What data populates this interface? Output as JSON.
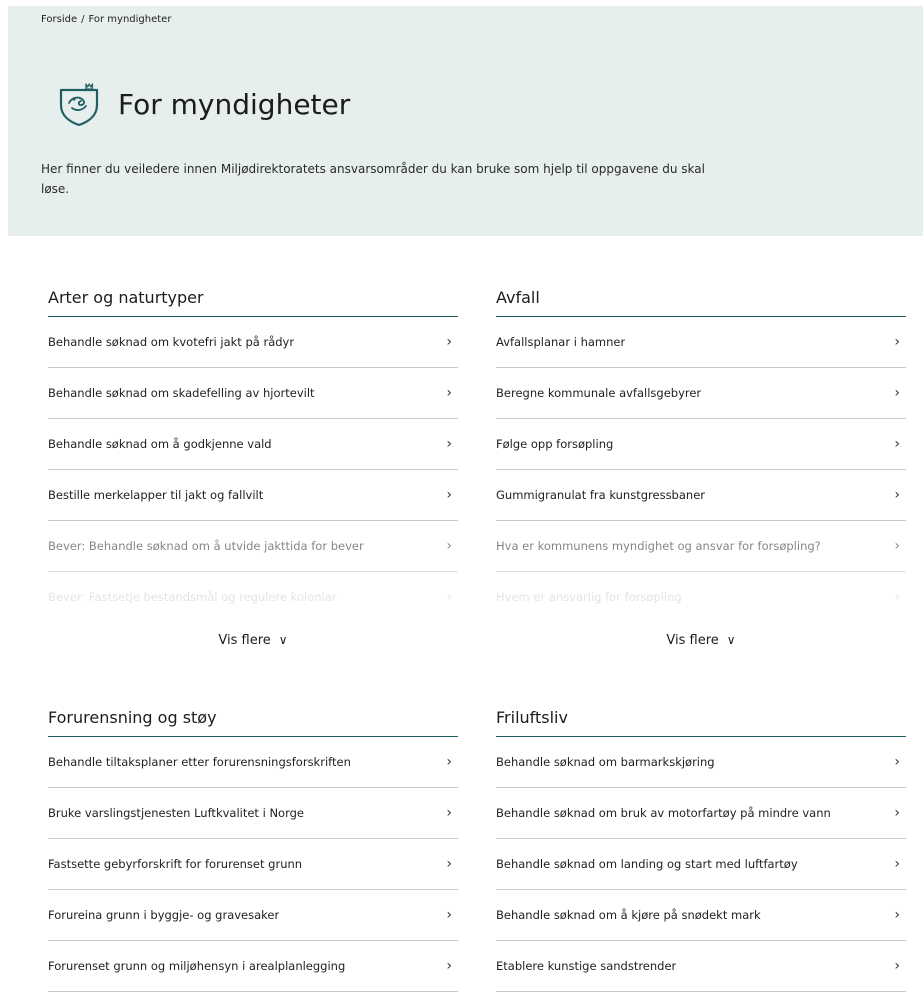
{
  "breadcrumb": {
    "home": "Forside",
    "separator": "/",
    "current": "For myndigheter"
  },
  "header": {
    "title": "For myndigheter",
    "intro": "Her finner du veiledere innen Miljødirektoratets ansvarsområder du kan bruke som hjelp til oppgavene du skal løse.",
    "icon": "authority-crest-icon"
  },
  "colors": {
    "hero_bg": "#e7eeee",
    "accent": "#1f5f62",
    "divider": "#c8c8c8"
  },
  "sections": [
    {
      "title": "Arter og naturtyper",
      "items": [
        "Behandle søknad om kvotefri jakt på rådyr",
        "Behandle søknad om skadefelling av hjortevilt",
        "Behandle søknad om å godkjenne vald",
        "Bestille merkelapper til jakt og fallvilt",
        "Bever: Behandle søknad om å utvide jakttida for bever",
        "Bever: Fastsetje bestandsmål og regulere koloniar"
      ],
      "more": "Vis flere"
    },
    {
      "title": "Avfall",
      "items": [
        "Avfallsplanar i hamner",
        "Beregne kommunale avfallsgebyrer",
        "Følge opp forsøpling",
        "Gummigranulat fra kunstgressbaner",
        "Hva er kommunens myndighet og ansvar for forsøpling?",
        "Hvem er ansvarlig for forsøpling"
      ],
      "more": "Vis flere"
    },
    {
      "title": "Forurensning og støy",
      "items": [
        "Behandle tiltaksplaner etter forurensningsforskriften",
        "Bruke varslingstjenesten Luftkvalitet i Norge",
        "Fastsette gebyrforskrift for forurenset grunn",
        "Forureina grunn i byggje- og gravesaker",
        "Forurenset grunn og miljøhensyn i arealplanlegging"
      ]
    },
    {
      "title": "Friluftsliv",
      "items": [
        "Behandle søknad om barmarkskjøring",
        "Behandle søknad om bruk av motorfartøy på mindre vann",
        "Behandle søknad om landing og start med luftfartøy",
        "Behandle søknad om å kjøre på snødekt mark",
        "Etablere kunstige sandstrender"
      ]
    }
  ]
}
